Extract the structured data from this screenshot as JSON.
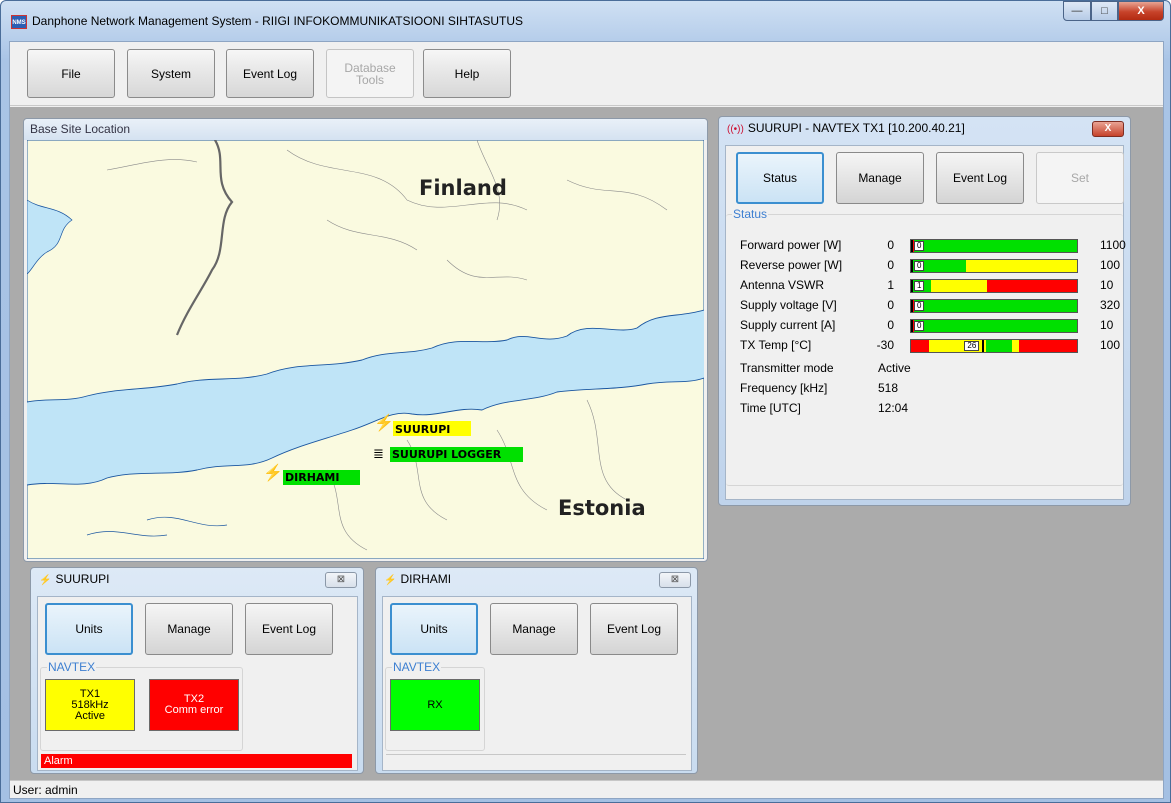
{
  "window": {
    "title": "Danphone Network Management System - RIIGI INFOKOMMUNIKATSIOONI SIHTASUTUS",
    "icon_text": "NMS",
    "caption_min": "—",
    "caption_max": "□",
    "caption_close": "X"
  },
  "toolbar": {
    "file": "File",
    "system": "System",
    "event_log": "Event Log",
    "database_tools_line1": "Database",
    "database_tools_line2": "Tools",
    "help": "Help"
  },
  "map": {
    "header": "Base Site Location",
    "labels": {
      "finland": "Finland",
      "estonia": "Estonia"
    },
    "sites": {
      "suurupi": "SUURUPI",
      "suurupi_logger": "SUURUPI LOGGER",
      "dirhami": "DIRHAMI"
    },
    "colors": {
      "sea": "#bfe4f7",
      "land": "#fafae0",
      "suurupi_label": "#ffff00",
      "logger_label": "#00e000",
      "dirhami_label": "#00e000"
    }
  },
  "tx_window": {
    "title": "SUURUPI - NAVTEX TX1 [10.200.40.21]",
    "close": "X",
    "buttons": {
      "status": "Status",
      "manage": "Manage",
      "event_log": "Event Log",
      "set": "Set"
    },
    "group_label": "Status",
    "rows": [
      {
        "label": "Forward power [W]",
        "min": "0",
        "max": "1100",
        "value": "0",
        "value_fraction": 0,
        "segments": [
          {
            "color": "#ff0000",
            "fraction": 0.02
          },
          {
            "color": "#00e000",
            "fraction": 0.98
          }
        ]
      },
      {
        "label": "Reverse power [W]",
        "min": "0",
        "max": "100",
        "value": "0",
        "value_fraction": 0,
        "segments": [
          {
            "color": "#00e000",
            "fraction": 0.33
          },
          {
            "color": "#ffff00",
            "fraction": 0.67
          }
        ]
      },
      {
        "label": "Antenna VSWR",
        "min": "1",
        "max": "10",
        "value": "1",
        "value_fraction": 0,
        "segments": [
          {
            "color": "#00e000",
            "fraction": 0.12
          },
          {
            "color": "#ffff00",
            "fraction": 0.34
          },
          {
            "color": "#ff0000",
            "fraction": 0.54
          }
        ]
      },
      {
        "label": "Supply voltage [V]",
        "min": "0",
        "max": "320",
        "value": "0",
        "value_fraction": 0,
        "segments": [
          {
            "color": "#ff0000",
            "fraction": 0.02
          },
          {
            "color": "#00e000",
            "fraction": 0.98
          }
        ]
      },
      {
        "label": "Supply current [A]",
        "min": "0",
        "max": "10",
        "value": "0",
        "value_fraction": 0,
        "segments": [
          {
            "color": "#ff0000",
            "fraction": 0.02
          },
          {
            "color": "#00e000",
            "fraction": 0.98
          }
        ]
      },
      {
        "label": "TX Temp [°C]",
        "min": "-30",
        "max": "100",
        "value": "26",
        "value_fraction": 0.43,
        "segments": [
          {
            "color": "#ff0000",
            "fraction": 0.11
          },
          {
            "color": "#ffff00",
            "fraction": 0.34
          },
          {
            "color": "#00e000",
            "fraction": 0.16
          },
          {
            "color": "#ffff00",
            "fraction": 0.04
          },
          {
            "color": "#ff0000",
            "fraction": 0.35
          }
        ]
      }
    ],
    "info": [
      {
        "key": "Transmitter mode",
        "value": "Active"
      },
      {
        "key": "Frequency [kHz]",
        "value": "518"
      },
      {
        "key": "Time [UTC]",
        "value": "12:04"
      }
    ]
  },
  "suurupi_window": {
    "title": "SUURUPI",
    "close": "⊠",
    "buttons": {
      "units": "Units",
      "manage": "Manage",
      "event_log": "Event Log"
    },
    "group_label": "NAVTEX",
    "tx1": {
      "line1": "TX1",
      "line2": "518kHz",
      "line3": "Active",
      "color": "#ffff00"
    },
    "tx2": {
      "line1": "TX2",
      "line2": "Comm error",
      "color": "#ff0000"
    },
    "alarm": "Alarm"
  },
  "dirhami_window": {
    "title": "DIRHAMI",
    "close": "⊠",
    "buttons": {
      "units": "Units",
      "manage": "Manage",
      "event_log": "Event Log"
    },
    "group_label": "NAVTEX",
    "rx": {
      "label": "RX",
      "color": "#00ff00"
    }
  },
  "status_bar": {
    "user": "User: admin"
  }
}
